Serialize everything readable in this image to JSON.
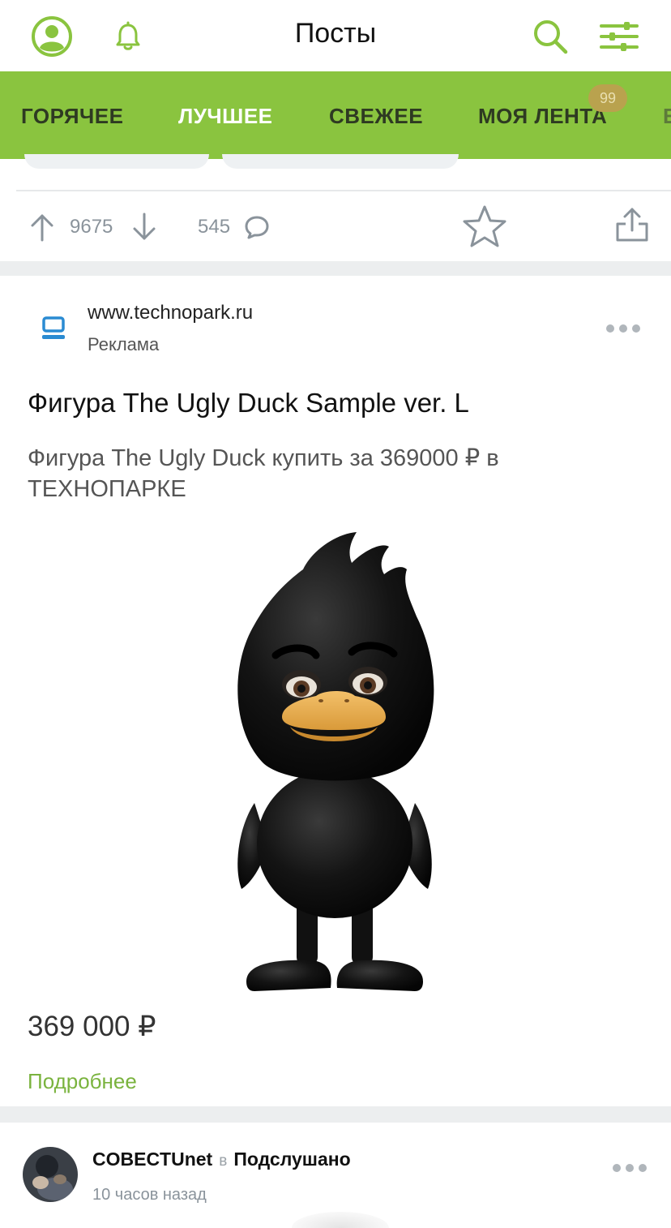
{
  "header": {
    "title": "Посты",
    "icons": {
      "profile": "profile-icon",
      "bell": "bell-icon",
      "search": "search-icon",
      "settings": "sliders-icon"
    },
    "accent": "#8ac43f"
  },
  "tabs": {
    "items": [
      {
        "label": "ГОРЯЧЕЕ",
        "active": false
      },
      {
        "label": "ЛУЧШЕЕ",
        "active": true
      },
      {
        "label": "СВЕЖЕЕ",
        "active": false
      },
      {
        "label": "МОЯ ЛЕНТА",
        "active": false
      }
    ],
    "feed_badge": "99",
    "overflow": "Е"
  },
  "prev_post": {
    "upvotes": "9675",
    "comments": "545"
  },
  "ad": {
    "url": "www.technopark.ru",
    "label": "Реклама",
    "title": "Фигура The Ugly Duck Sample ver. L",
    "description": "Фигура The Ugly Duck купить за 369000 ₽ в ТЕХНОПАРКЕ",
    "price": "369 000 ₽",
    "more": "Подробнее"
  },
  "next_post": {
    "author": "COBECTUnet",
    "in": "в",
    "community": "Подслушано",
    "time": "10 часов назад"
  }
}
